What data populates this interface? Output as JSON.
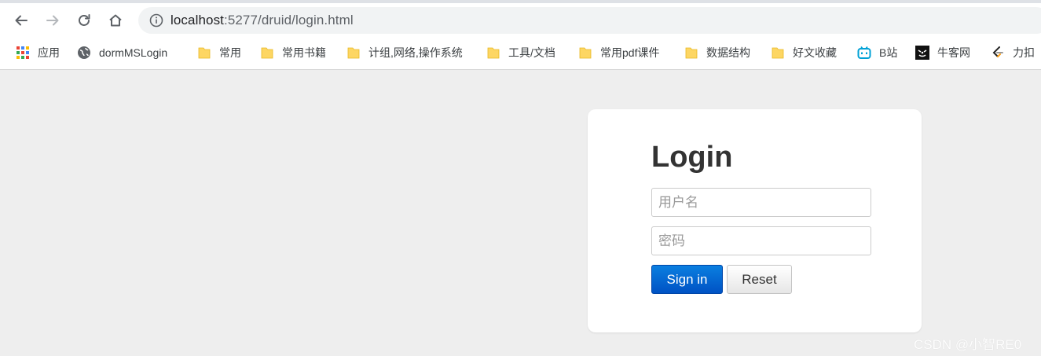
{
  "browser": {
    "address_bar": {
      "host": "localhost",
      "rest": ":5277/druid/login.html"
    },
    "bookmarks": [
      {
        "label": "应用",
        "icon": "apps-grid-icon"
      },
      {
        "label": "dormMSLogin",
        "icon": "globe-icon"
      },
      {
        "label": "常用",
        "icon": "folder-icon"
      },
      {
        "label": "常用书籍",
        "icon": "folder-icon"
      },
      {
        "label": "计组,网络,操作系统",
        "icon": "folder-icon"
      },
      {
        "label": "工具/文档",
        "icon": "folder-icon"
      },
      {
        "label": "常用pdf课件",
        "icon": "folder-icon"
      },
      {
        "label": "数据结构",
        "icon": "folder-icon"
      },
      {
        "label": "好文收藏",
        "icon": "folder-icon"
      },
      {
        "label": "B站",
        "icon": "bilibili-icon"
      },
      {
        "label": "牛客网",
        "icon": "nowcoder-icon"
      },
      {
        "label": "力扣",
        "icon": "leetcode-icon"
      }
    ]
  },
  "login": {
    "title": "Login",
    "username_placeholder": "用户名",
    "password_placeholder": "密码",
    "signin_label": "Sign in",
    "reset_label": "Reset"
  },
  "watermark": "CSDN @小智RE0",
  "colors": {
    "page_bg": "#eeeeee",
    "primary_button": "#0066d4",
    "folder": "#fdd663",
    "bilibili": "#00a1d6"
  }
}
